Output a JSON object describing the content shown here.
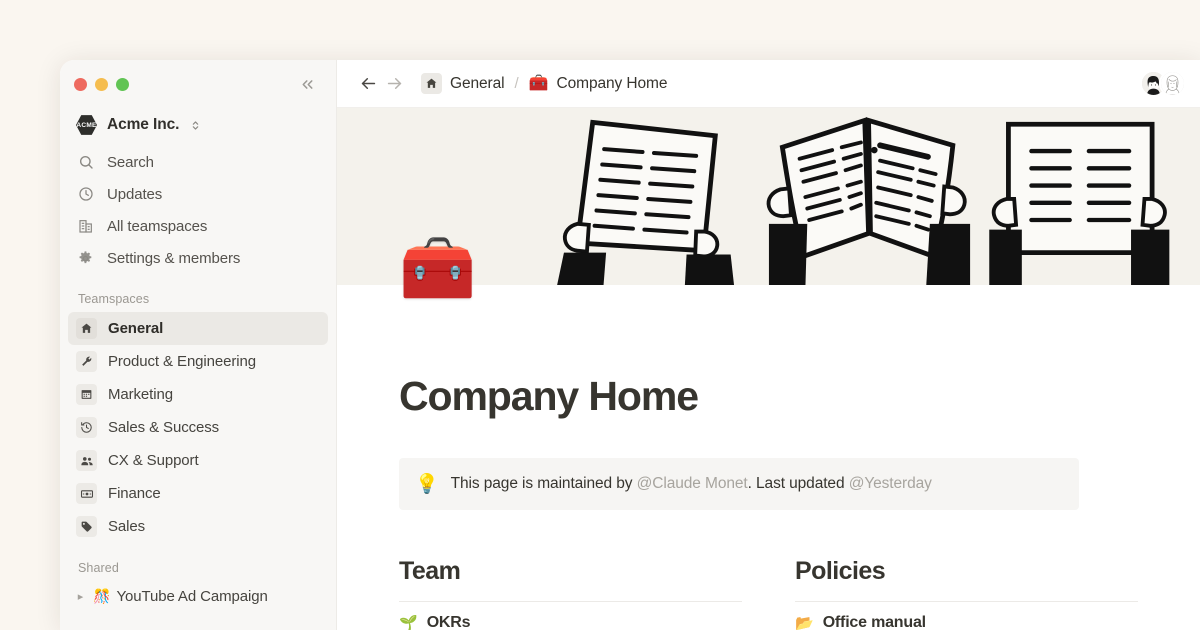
{
  "window": {
    "traffic_lights": [
      {
        "name": "close",
        "color": "#ee6a5f"
      },
      {
        "name": "minimize",
        "color": "#f5bd4f"
      },
      {
        "name": "maximize",
        "color": "#61c454"
      }
    ],
    "collapse_tooltip": "Collapse sidebar"
  },
  "sidebar": {
    "workspace": {
      "badge_text": "ACME",
      "name": "Acme Inc."
    },
    "nav": [
      {
        "icon": "search-icon",
        "label": "Search"
      },
      {
        "icon": "clock-icon",
        "label": "Updates"
      },
      {
        "icon": "buildings-icon",
        "label": "All teamspaces"
      },
      {
        "icon": "gear-icon",
        "label": "Settings & members"
      }
    ],
    "teamspaces_label": "Teamspaces",
    "teamspaces": [
      {
        "icon": "home-icon",
        "label": "General",
        "active": true
      },
      {
        "icon": "wrench-icon",
        "label": "Product & Engineering",
        "active": false
      },
      {
        "icon": "calendar-icon",
        "label": "Marketing",
        "active": false
      },
      {
        "icon": "clock-rotate-icon",
        "label": "Sales & Success",
        "active": false
      },
      {
        "icon": "people-icon",
        "label": "CX & Support",
        "active": false
      },
      {
        "icon": "banknote-icon",
        "label": "Finance",
        "active": false
      },
      {
        "icon": "tag-icon",
        "label": "Sales",
        "active": false
      }
    ],
    "shared_label": "Shared",
    "shared": [
      {
        "emoji": "🎊",
        "label": "YouTube Ad Campaign"
      }
    ]
  },
  "topbar": {
    "back_label": "←",
    "forward_label": "→",
    "breadcrumb": [
      {
        "icon": "home-icon",
        "label": "General"
      },
      {
        "emoji": "🧰",
        "label": "Company Home"
      }
    ],
    "separator": "/",
    "avatars": [
      {
        "name": "avatar-user-1"
      },
      {
        "name": "avatar-user-2"
      }
    ]
  },
  "page": {
    "cover_alt": "People holding documents illustration",
    "icon_emoji": "🧰",
    "title": "Company Home",
    "callout": {
      "emoji": "💡",
      "text_before": "This page is maintained by ",
      "mention_person": "@Claude Monet",
      "text_middle": ". Last updated ",
      "mention_date": "@Yesterday"
    },
    "columns": [
      {
        "heading": "Team",
        "items": [
          {
            "emoji": "🌱",
            "label": "OKRs"
          }
        ]
      },
      {
        "heading": "Policies",
        "items": [
          {
            "emoji": "📂",
            "label": "Office manual"
          }
        ]
      }
    ]
  },
  "colors": {
    "page_background": "#faf6f0",
    "sidebar_background": "#f8f7f5",
    "content_background": "#ffffff",
    "hero_background": "#f4f2ec",
    "text_primary": "#37352f",
    "text_muted": "#a7a49e"
  }
}
